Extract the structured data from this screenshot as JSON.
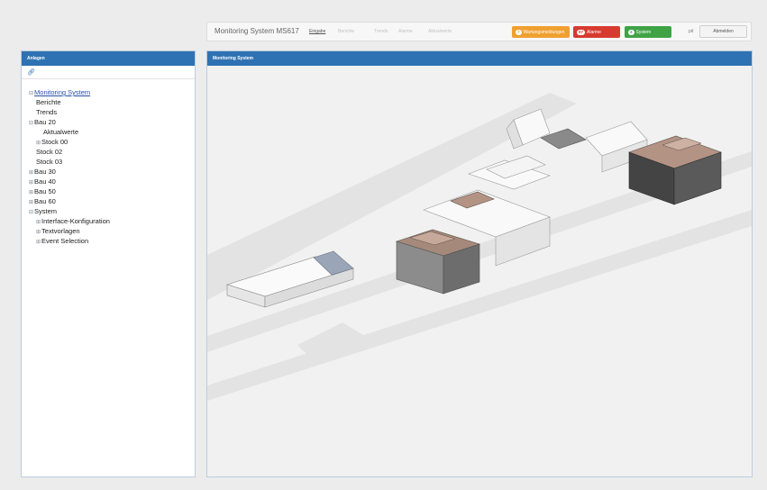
{
  "header": {
    "title": "Monitoring System MS617",
    "nav": [
      "Eingabe",
      "Berichte",
      "Trends",
      "Alarme",
      "Aktualwerte"
    ],
    "badges": [
      {
        "count": "7",
        "label": "Wartungsmeldungen",
        "color": "#f0a030"
      },
      {
        "count": "97",
        "label": "Alarme",
        "color": "#d73b30"
      },
      {
        "count": "3",
        "label": "System",
        "color": "#3fa346"
      }
    ],
    "user": "pit",
    "logout_label": "Abmelden"
  },
  "left_panel": {
    "title": "Anlagen",
    "link_icon": "link-icon",
    "tree": [
      {
        "label": "Monitoring System",
        "indent": 0,
        "toggle": "⊟",
        "link": true
      },
      {
        "label": "Berichte",
        "indent": 1,
        "toggle": ""
      },
      {
        "label": "Trends",
        "indent": 1,
        "toggle": ""
      },
      {
        "label": "Bau 20",
        "indent": 0,
        "toggle": "⊟"
      },
      {
        "label": "Aktualwerte",
        "indent": 2,
        "toggle": ""
      },
      {
        "label": "Stock 00",
        "indent": 1,
        "toggle": "⊞"
      },
      {
        "label": "Stock 02",
        "indent": 1,
        "toggle": ""
      },
      {
        "label": "Stock 03",
        "indent": 1,
        "toggle": ""
      },
      {
        "label": "Bau 30",
        "indent": 0,
        "toggle": "⊞"
      },
      {
        "label": "Bau 40",
        "indent": 0,
        "toggle": "⊞"
      },
      {
        "label": "Bau 50",
        "indent": 0,
        "toggle": "⊞"
      },
      {
        "label": "Bau 60",
        "indent": 0,
        "toggle": "⊞"
      },
      {
        "label": "System",
        "indent": 0,
        "toggle": "⊟"
      },
      {
        "label": "Interface-Konfiguration",
        "indent": 1,
        "toggle": "⊞"
      },
      {
        "label": "Textvorlagen",
        "indent": 1,
        "toggle": "⊞"
      },
      {
        "label": "Event Selection",
        "indent": 1,
        "toggle": "⊞"
      }
    ]
  },
  "main_panel": {
    "title": "Monitoring System"
  }
}
